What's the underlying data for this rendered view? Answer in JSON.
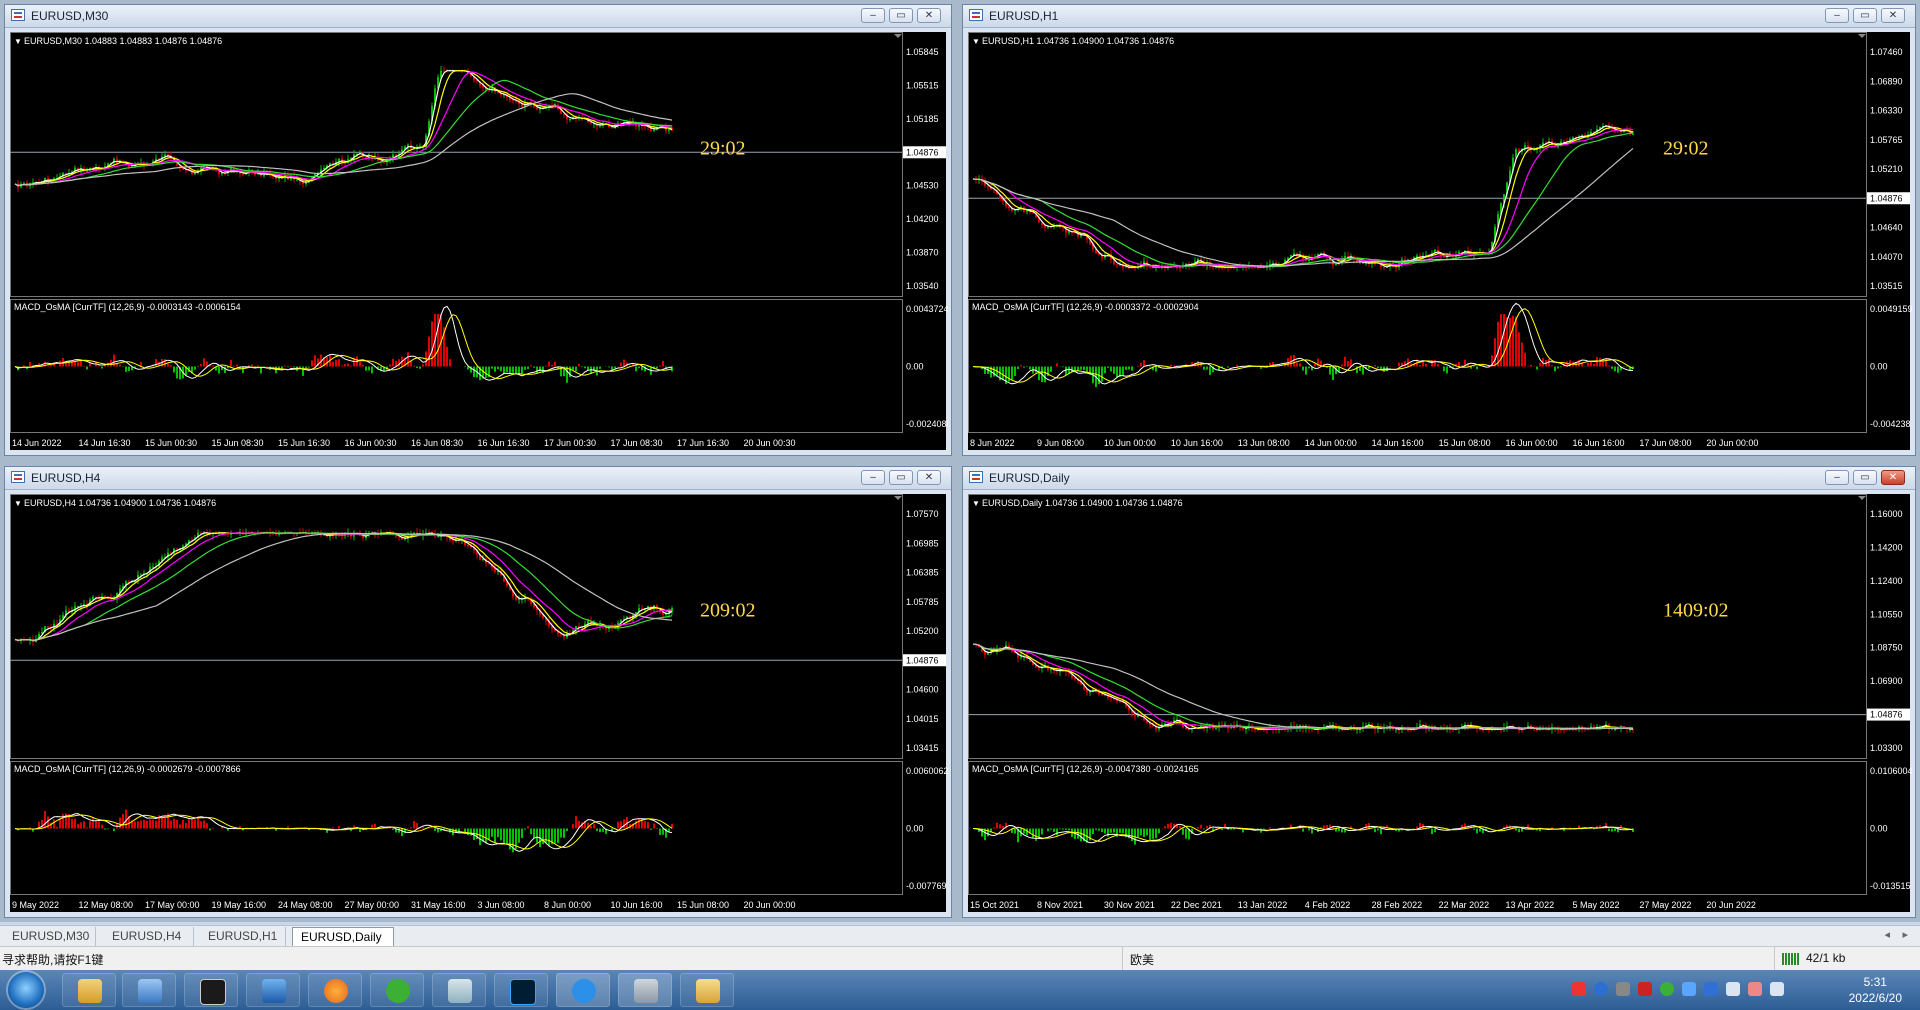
{
  "windows": [
    {
      "id": "m30",
      "title": "EURUSD,M30",
      "header": "EURUSD,M30  1.04883 1.04883 1.04876 1.04876",
      "price_ticks": [
        "1.05845",
        "1.05515",
        "1.05185",
        "1.04876",
        "1.04530",
        "1.04200",
        "1.03870",
        "1.03540"
      ],
      "macd_label": "MACD_OsMA [CurrTF] (12,26,9) -0.0003143 -0.0006154",
      "macd_ticks": [
        "0.0043724",
        "0.00",
        "-0.0024086"
      ],
      "time_labels": [
        "14 Jun 2022",
        "14 Jun 16:30",
        "15 Jun 00:30",
        "15 Jun 08:30",
        "15 Jun 16:30",
        "16 Jun 00:30",
        "16 Jun 08:30",
        "16 Jun 16:30",
        "17 Jun 00:30",
        "17 Jun 08:30",
        "17 Jun 16:30",
        "20 Jun 00:30"
      ],
      "timer": "29:02"
    },
    {
      "id": "h1",
      "title": "EURUSD,H1",
      "header": "EURUSD,H1  1.04736 1.04900 1.04736 1.04876",
      "price_ticks": [
        "1.07460",
        "1.06890",
        "1.06330",
        "1.05765",
        "1.05210",
        "1.04876",
        "1.04640",
        "1.04070",
        "1.03515"
      ],
      "macd_label": "MACD_OsMA [CurrTF] (12,26,9) -0.0003372 -0.0002904",
      "macd_ticks": [
        "0.0049159",
        "0.00",
        "-0.004238"
      ],
      "time_labels": [
        "8 Jun 2022",
        "9 Jun 08:00",
        "10 Jun 00:00",
        "10 Jun 16:00",
        "13 Jun 08:00",
        "14 Jun 00:00",
        "14 Jun 16:00",
        "15 Jun 08:00",
        "16 Jun 00:00",
        "16 Jun 16:00",
        "17 Jun 08:00",
        "20 Jun 00:00"
      ],
      "timer": "29:02"
    },
    {
      "id": "h4",
      "title": "EURUSD,H4",
      "header": "EURUSD,H4  1.04736 1.04900 1.04736 1.04876",
      "price_ticks": [
        "1.07570",
        "1.06985",
        "1.06385",
        "1.05785",
        "1.05200",
        "1.04876",
        "1.04600",
        "1.04015",
        "1.03415"
      ],
      "macd_label": "MACD_OsMA [CurrTF] (12,26,9) -0.0002679 -0.0007866",
      "macd_ticks": [
        "0.0060062",
        "0.00",
        "-0.007769"
      ],
      "time_labels": [
        "9 May 2022",
        "12 May 08:00",
        "17 May 00:00",
        "19 May 16:00",
        "24 May 08:00",
        "27 May 00:00",
        "31 May 16:00",
        "3 Jun 08:00",
        "8 Jun 00:00",
        "10 Jun 16:00",
        "15 Jun 08:00",
        "20 Jun 00:00"
      ],
      "timer": "209:02"
    },
    {
      "id": "d1",
      "title": "EURUSD,Daily",
      "header": "EURUSD,Daily  1.04736 1.04900 1.04736 1.04876",
      "price_ticks": [
        "1.16000",
        "1.14200",
        "1.12400",
        "1.10550",
        "1.08750",
        "1.06900",
        "1.04876",
        "1.03300"
      ],
      "macd_label": "MACD_OsMA [CurrTF] (12,26,9) -0.0047380 -0.0024165",
      "macd_ticks": [
        "0.0106004",
        "0.00",
        "-0.013515"
      ],
      "time_labels": [
        "15 Oct 2021",
        "8 Nov 2021",
        "30 Nov 2021",
        "22 Dec 2021",
        "13 Jan 2022",
        "4 Feb 2022",
        "28 Feb 2022",
        "22 Mar 2022",
        "13 Apr 2022",
        "5 May 2022",
        "27 May 2022",
        "20 Jun 2022"
      ],
      "timer": "1409:02"
    }
  ],
  "tabs": [
    "EURUSD,M30",
    "EURUSD,H4",
    "EURUSD,H1",
    "EURUSD,Daily"
  ],
  "status": {
    "help": "寻求帮助,请按F1键",
    "profile": "欧美",
    "traffic": "42/1 kb"
  },
  "clock": {
    "time": "5:31",
    "date": "2022/6/20"
  },
  "colors": {
    "bull": "#00c000",
    "bear": "#e00000",
    "ma_fast": "#ffffff",
    "ma_yellow": "#ffff00",
    "ma_magenta": "#ff00ff",
    "ma_green": "#33dd33",
    "ma_gray": "#c0c0c0",
    "timer": "#ffd84a"
  },
  "icons": [
    "window-icon",
    "minimize-icon",
    "restore-icon",
    "close-icon",
    "start-orb-icon"
  ]
}
